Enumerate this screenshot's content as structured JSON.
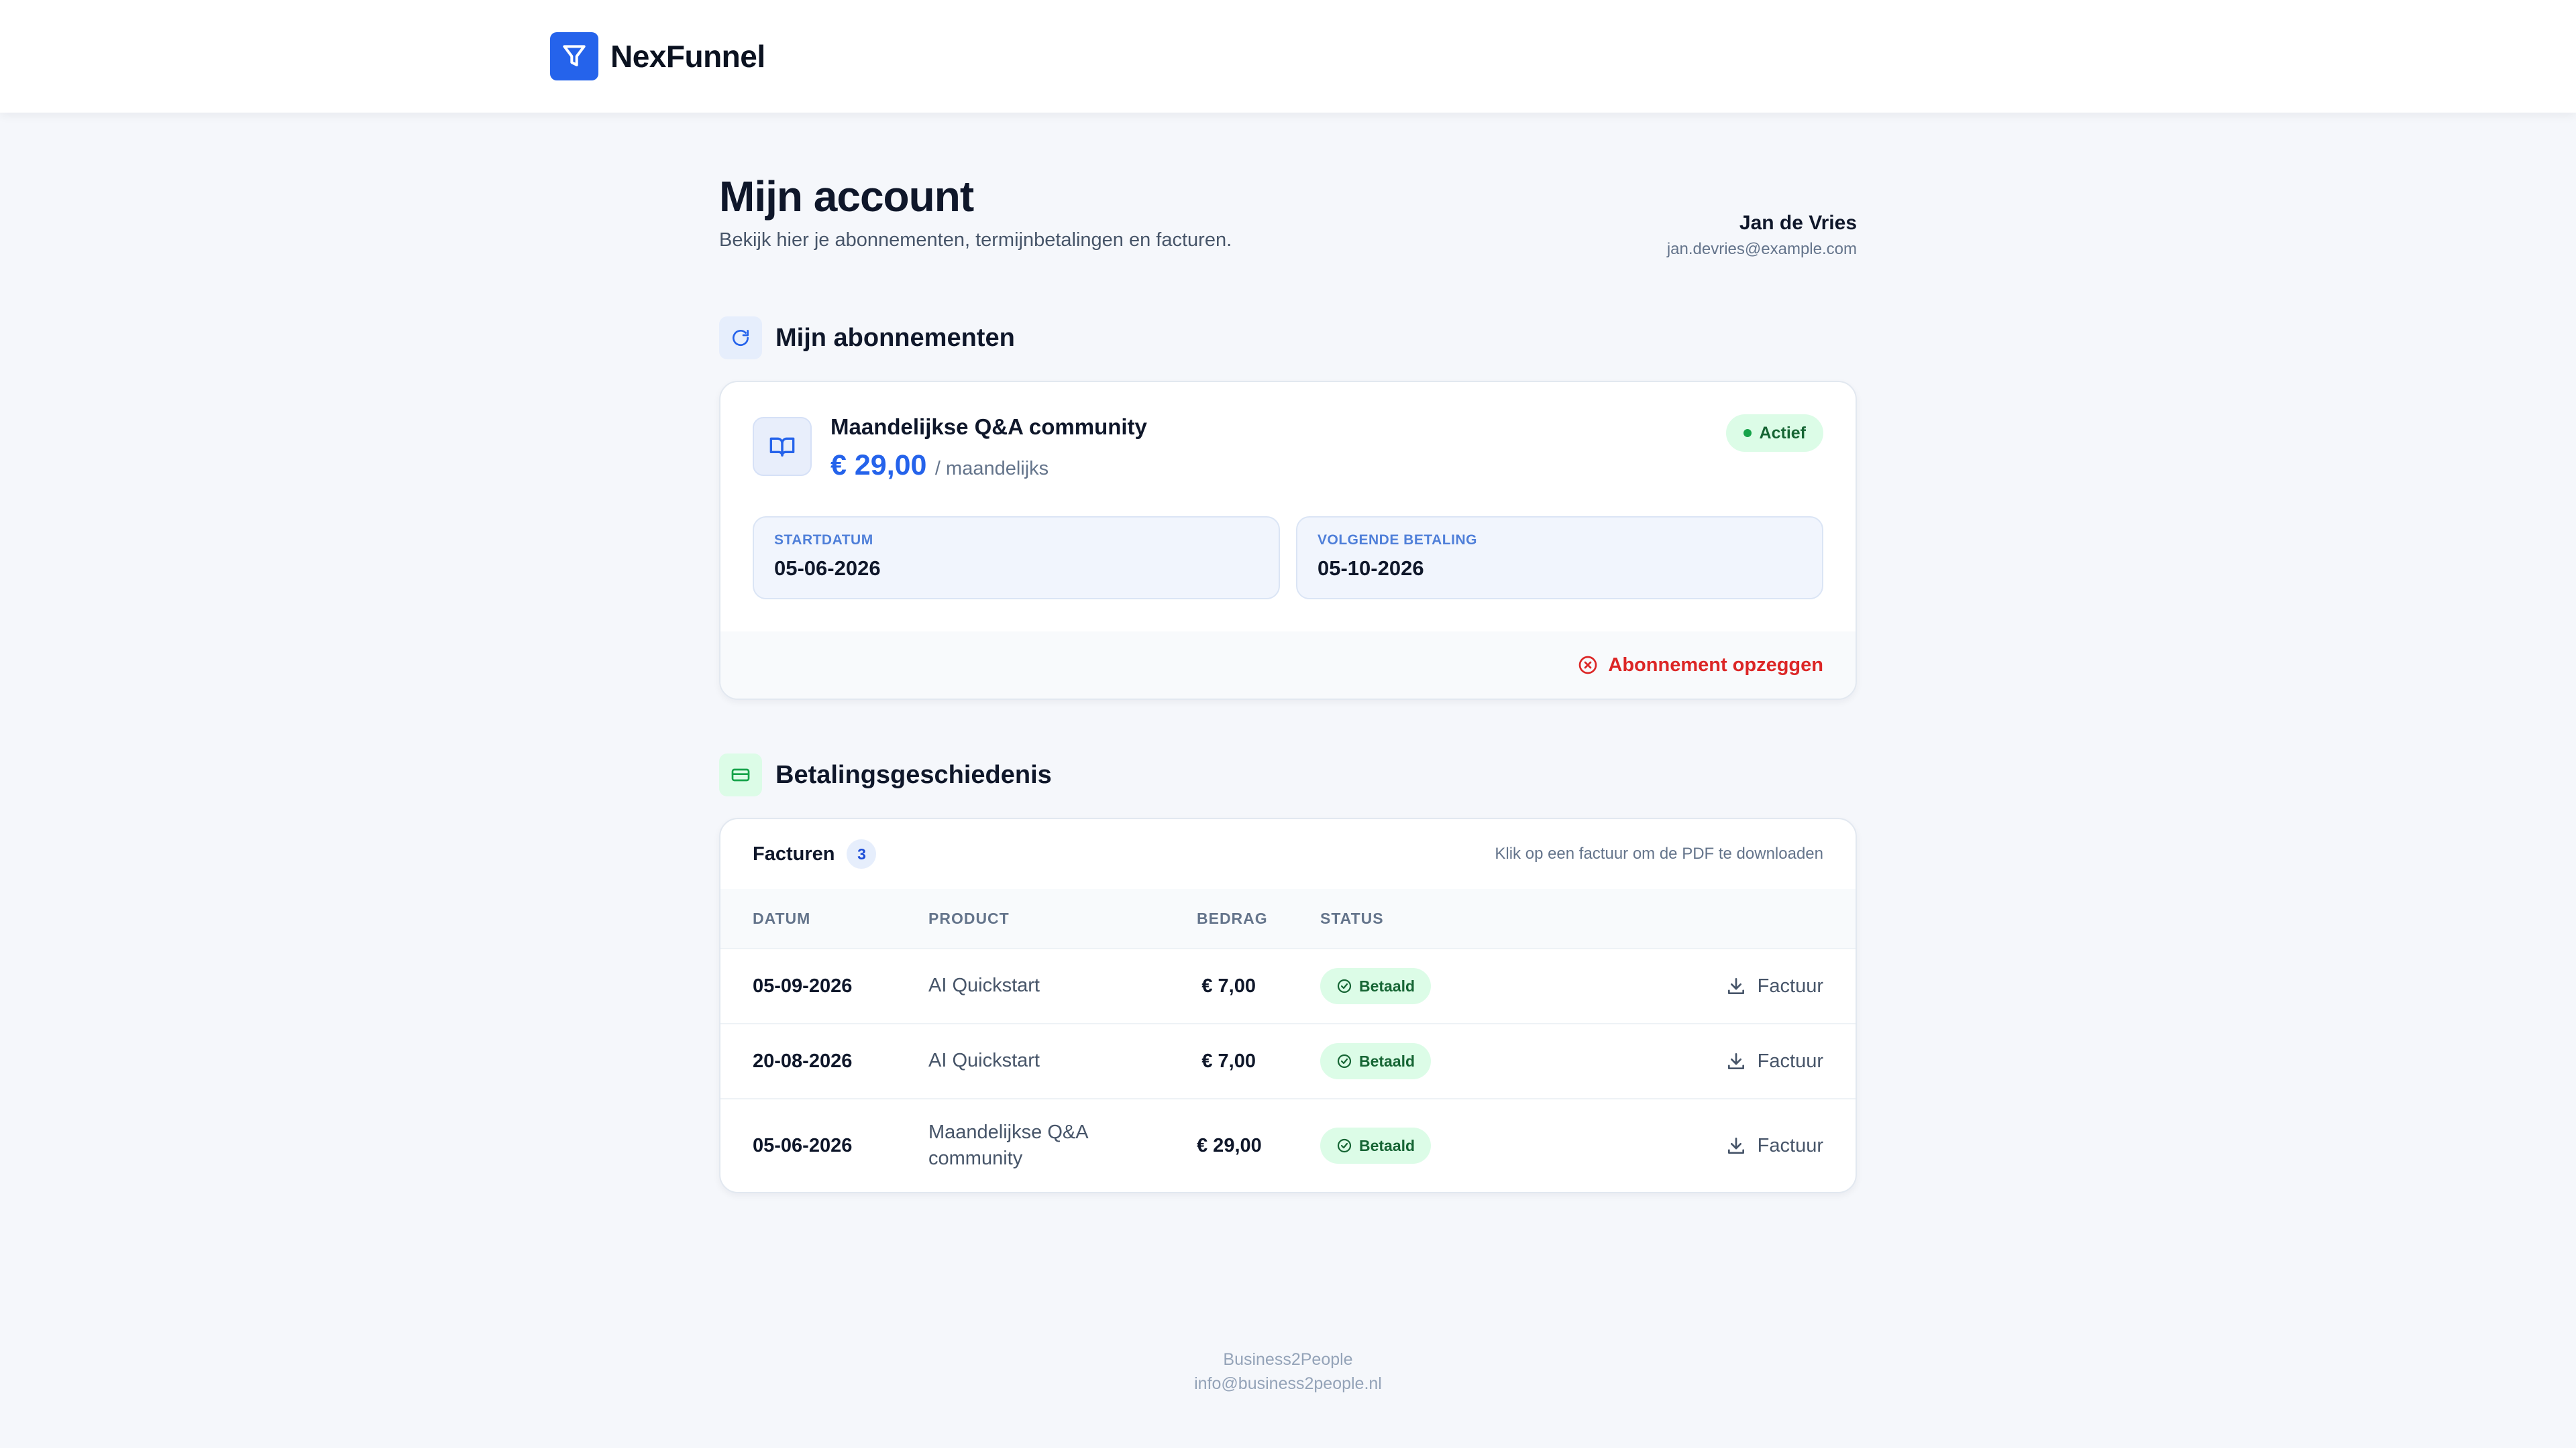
{
  "brand": {
    "name": "NexFunnel"
  },
  "header": {
    "title": "Mijn account",
    "subtitle": "Bekijk hier je abonnementen, termijnbetalingen en facturen."
  },
  "user": {
    "name": "Jan de Vries",
    "email": "jan.devries@example.com"
  },
  "subscriptions": {
    "title": "Mijn abonnementen",
    "items": [
      {
        "name": "Maandelijkse Q&A community",
        "price": "€ 29,00",
        "period": "/ maandelijks",
        "status": "Actief",
        "start_label": "STARTDATUM",
        "start_value": "05-06-2026",
        "next_label": "VOLGENDE BETALING",
        "next_value": "05-10-2026",
        "cancel_label": "Abonnement opzeggen"
      }
    ]
  },
  "payments": {
    "title": "Betalingsgeschiedenis",
    "invoices_label": "Facturen",
    "invoices_count": "3",
    "hint": "Klik op een factuur om de PDF te downloaden",
    "columns": [
      "DATUM",
      "PRODUCT",
      "BEDRAG",
      "STATUS"
    ],
    "rows": [
      {
        "date": "05-09-2026",
        "product": "AI Quickstart",
        "amount": "€ 7,00",
        "status": "Betaald",
        "action": "Factuur"
      },
      {
        "date": "20-08-2026",
        "product": "AI Quickstart",
        "amount": "€ 7,00",
        "status": "Betaald",
        "action": "Factuur"
      },
      {
        "date": "05-06-2026",
        "product": "Maandelijkse Q&A community",
        "amount": "€ 29,00",
        "status": "Betaald",
        "action": "Factuur"
      }
    ]
  },
  "footer": {
    "company": "Business2People",
    "email": "info@business2people.nl"
  },
  "colors": {
    "accent": "#2563eb",
    "success": "#16a34a",
    "danger": "#dc2626"
  },
  "icons": {
    "logo": "funnel-icon",
    "subscriptions": "refresh-icon",
    "product": "book-icon",
    "payments": "credit-card-icon",
    "cancel": "x-circle-icon",
    "paid": "check-circle-icon",
    "download": "download-icon"
  }
}
